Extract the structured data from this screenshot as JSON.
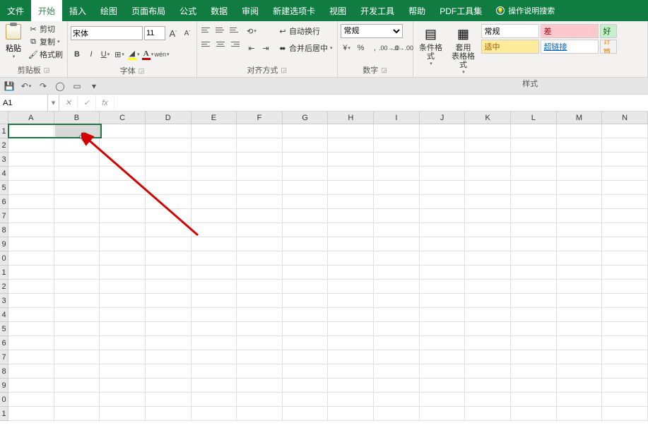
{
  "tabs": {
    "file": "文件",
    "home": "开始",
    "insert": "插入",
    "draw": "绘图",
    "layout": "页面布局",
    "formulas": "公式",
    "data": "数据",
    "review": "审阅",
    "newtab": "新建选项卡",
    "view": "视图",
    "dev": "开发工具",
    "help": "帮助",
    "pdf": "PDF工具集",
    "search": "操作说明搜索"
  },
  "clipboard": {
    "paste": "粘贴",
    "cut": "剪切",
    "copy": "复制",
    "painter": "格式刷",
    "label": "剪贴板"
  },
  "font": {
    "name": "宋体",
    "size": "11",
    "label": "字体"
  },
  "align": {
    "wrap": "自动换行",
    "merge": "合并后居中",
    "label": "对齐方式"
  },
  "number": {
    "format": "常规",
    "label": "数字"
  },
  "styles": {
    "cond": "条件格式",
    "table": "套用\n表格格式",
    "normal": "常规",
    "bad": "差",
    "good": "好",
    "neutral": "适中",
    "link": "超链接",
    "calc": "计算",
    "label": "样式"
  },
  "namebox": "A1",
  "columns": [
    "A",
    "B",
    "C",
    "D",
    "E",
    "F",
    "G",
    "H",
    "I",
    "J",
    "K",
    "L",
    "M",
    "N"
  ],
  "rows": [
    "1",
    "2",
    "3",
    "4",
    "5",
    "6",
    "7",
    "8",
    "9",
    "0",
    "1",
    "2",
    "3",
    "4",
    "5",
    "6",
    "7",
    "8",
    "9",
    "0",
    "1"
  ]
}
